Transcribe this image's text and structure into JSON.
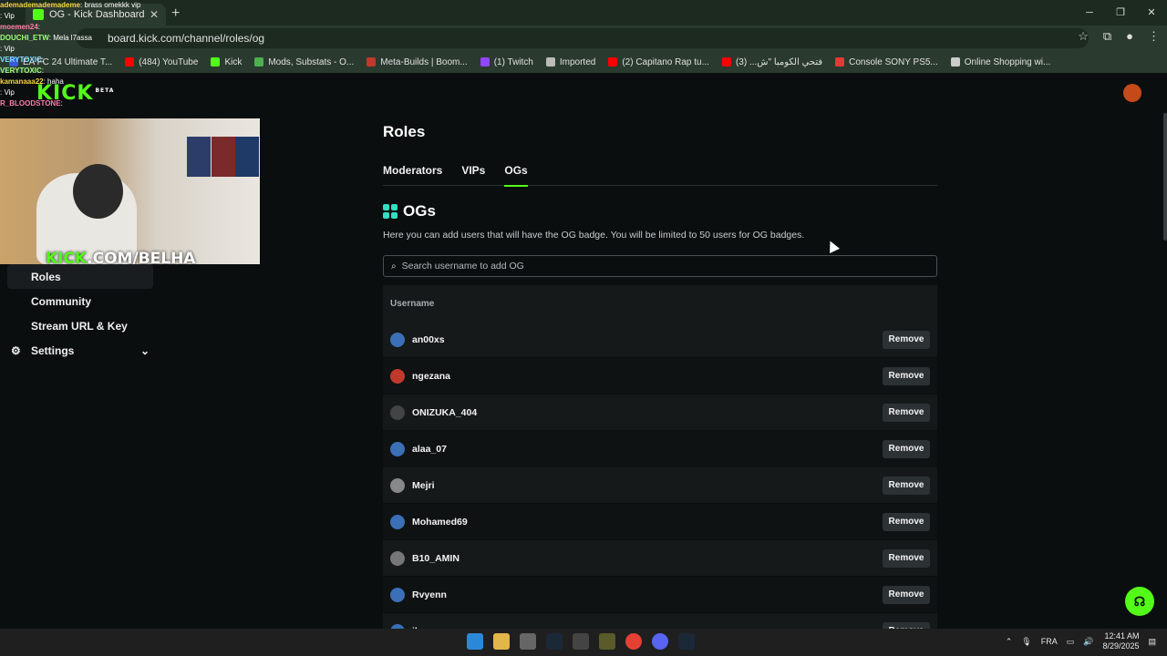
{
  "browser": {
    "tab_title": "OG - Kick Dashboard",
    "url": "board.kick.com/channel/roles/og",
    "bookmarks": [
      {
        "label": "EA FC 24 Ultimate T...",
        "color": "#3a5bd9"
      },
      {
        "label": "(484) YouTube",
        "color": "#ff0000"
      },
      {
        "label": "Kick",
        "color": "#53fc18"
      },
      {
        "label": "Mods, Substats - O...",
        "color": "#4caf50"
      },
      {
        "label": "Meta-Builds | Boom...",
        "color": "#c0392b"
      },
      {
        "label": "(1) Twitch",
        "color": "#9146ff"
      },
      {
        "label": "Imported",
        "color": "#bbbbbb"
      },
      {
        "label": "(2) Capitano Rap tu...",
        "color": "#ff0000"
      },
      {
        "label": "فتحي الكومبا \"ش... (3)",
        "color": "#ff0000"
      },
      {
        "label": "Console SONY PS5...",
        "color": "#e53935"
      },
      {
        "label": "Online Shopping wi...",
        "color": "#cccccc"
      }
    ]
  },
  "site": {
    "logo": "KICK",
    "logo_tag": "BETA"
  },
  "chat_overlay": [
    {
      "user": "ademademademademe",
      "msg": ": brass omekkk vip"
    },
    {
      "user": "",
      "msg": ": Vip"
    },
    {
      "user": "moemen24",
      "msg": ": "
    },
    {
      "user": "DOUCHI_ETW",
      "msg": ": Mela l7assa"
    },
    {
      "user": "",
      "msg": ": Vip"
    },
    {
      "user": "VERYTOXIC",
      "msg": ":"
    },
    {
      "user": "",
      "msg": ""
    },
    {
      "user": "VERYTOXIC",
      "msg": ":"
    },
    {
      "user": "kamanaaa22",
      "msg": ": haha"
    },
    {
      "user": "",
      "msg": ": Vip"
    },
    {
      "user": "R_BLOODSTONE",
      "msg": ":"
    }
  ],
  "webcam": {
    "brand_prefix": "KICK",
    "brand_suffix": ".COM/BELHA"
  },
  "sidebar": {
    "items": [
      {
        "label": "Roles",
        "active": true
      },
      {
        "label": "Community",
        "active": false
      },
      {
        "label": "Stream URL & Key",
        "active": false
      },
      {
        "label": "Settings",
        "active": false
      }
    ]
  },
  "page": {
    "title": "Roles",
    "tabs": [
      "Moderators",
      "VIPs",
      "OGs"
    ],
    "active_tab": "OGs",
    "section_title": "OGs",
    "description": "Here you can add users that will have the OG badge. You will be limited to 50 users for OG badges.",
    "search_placeholder": "Search username to add OG",
    "column_username": "Username",
    "remove_label": "Remove",
    "users": [
      {
        "name": "an00xs",
        "avatar_color": "#3b6fb6"
      },
      {
        "name": "ngezana",
        "avatar_color": "#c0392b"
      },
      {
        "name": "ONIZUKA_404",
        "avatar_color": "#444444"
      },
      {
        "name": "alaa_07",
        "avatar_color": "#3b6fb6"
      },
      {
        "name": "Mejri",
        "avatar_color": "#888888"
      },
      {
        "name": "Mohamed69",
        "avatar_color": "#3b6fb6"
      },
      {
        "name": "B10_AMIN",
        "avatar_color": "#777777"
      },
      {
        "name": "Rvyenn",
        "avatar_color": "#3b6fb6"
      },
      {
        "name": "ilyesgm",
        "avatar_color": "#3b6fb6"
      }
    ]
  },
  "taskbar": {
    "lang": "FRA",
    "time": "12:41 AM",
    "date": "8/29/2025"
  }
}
